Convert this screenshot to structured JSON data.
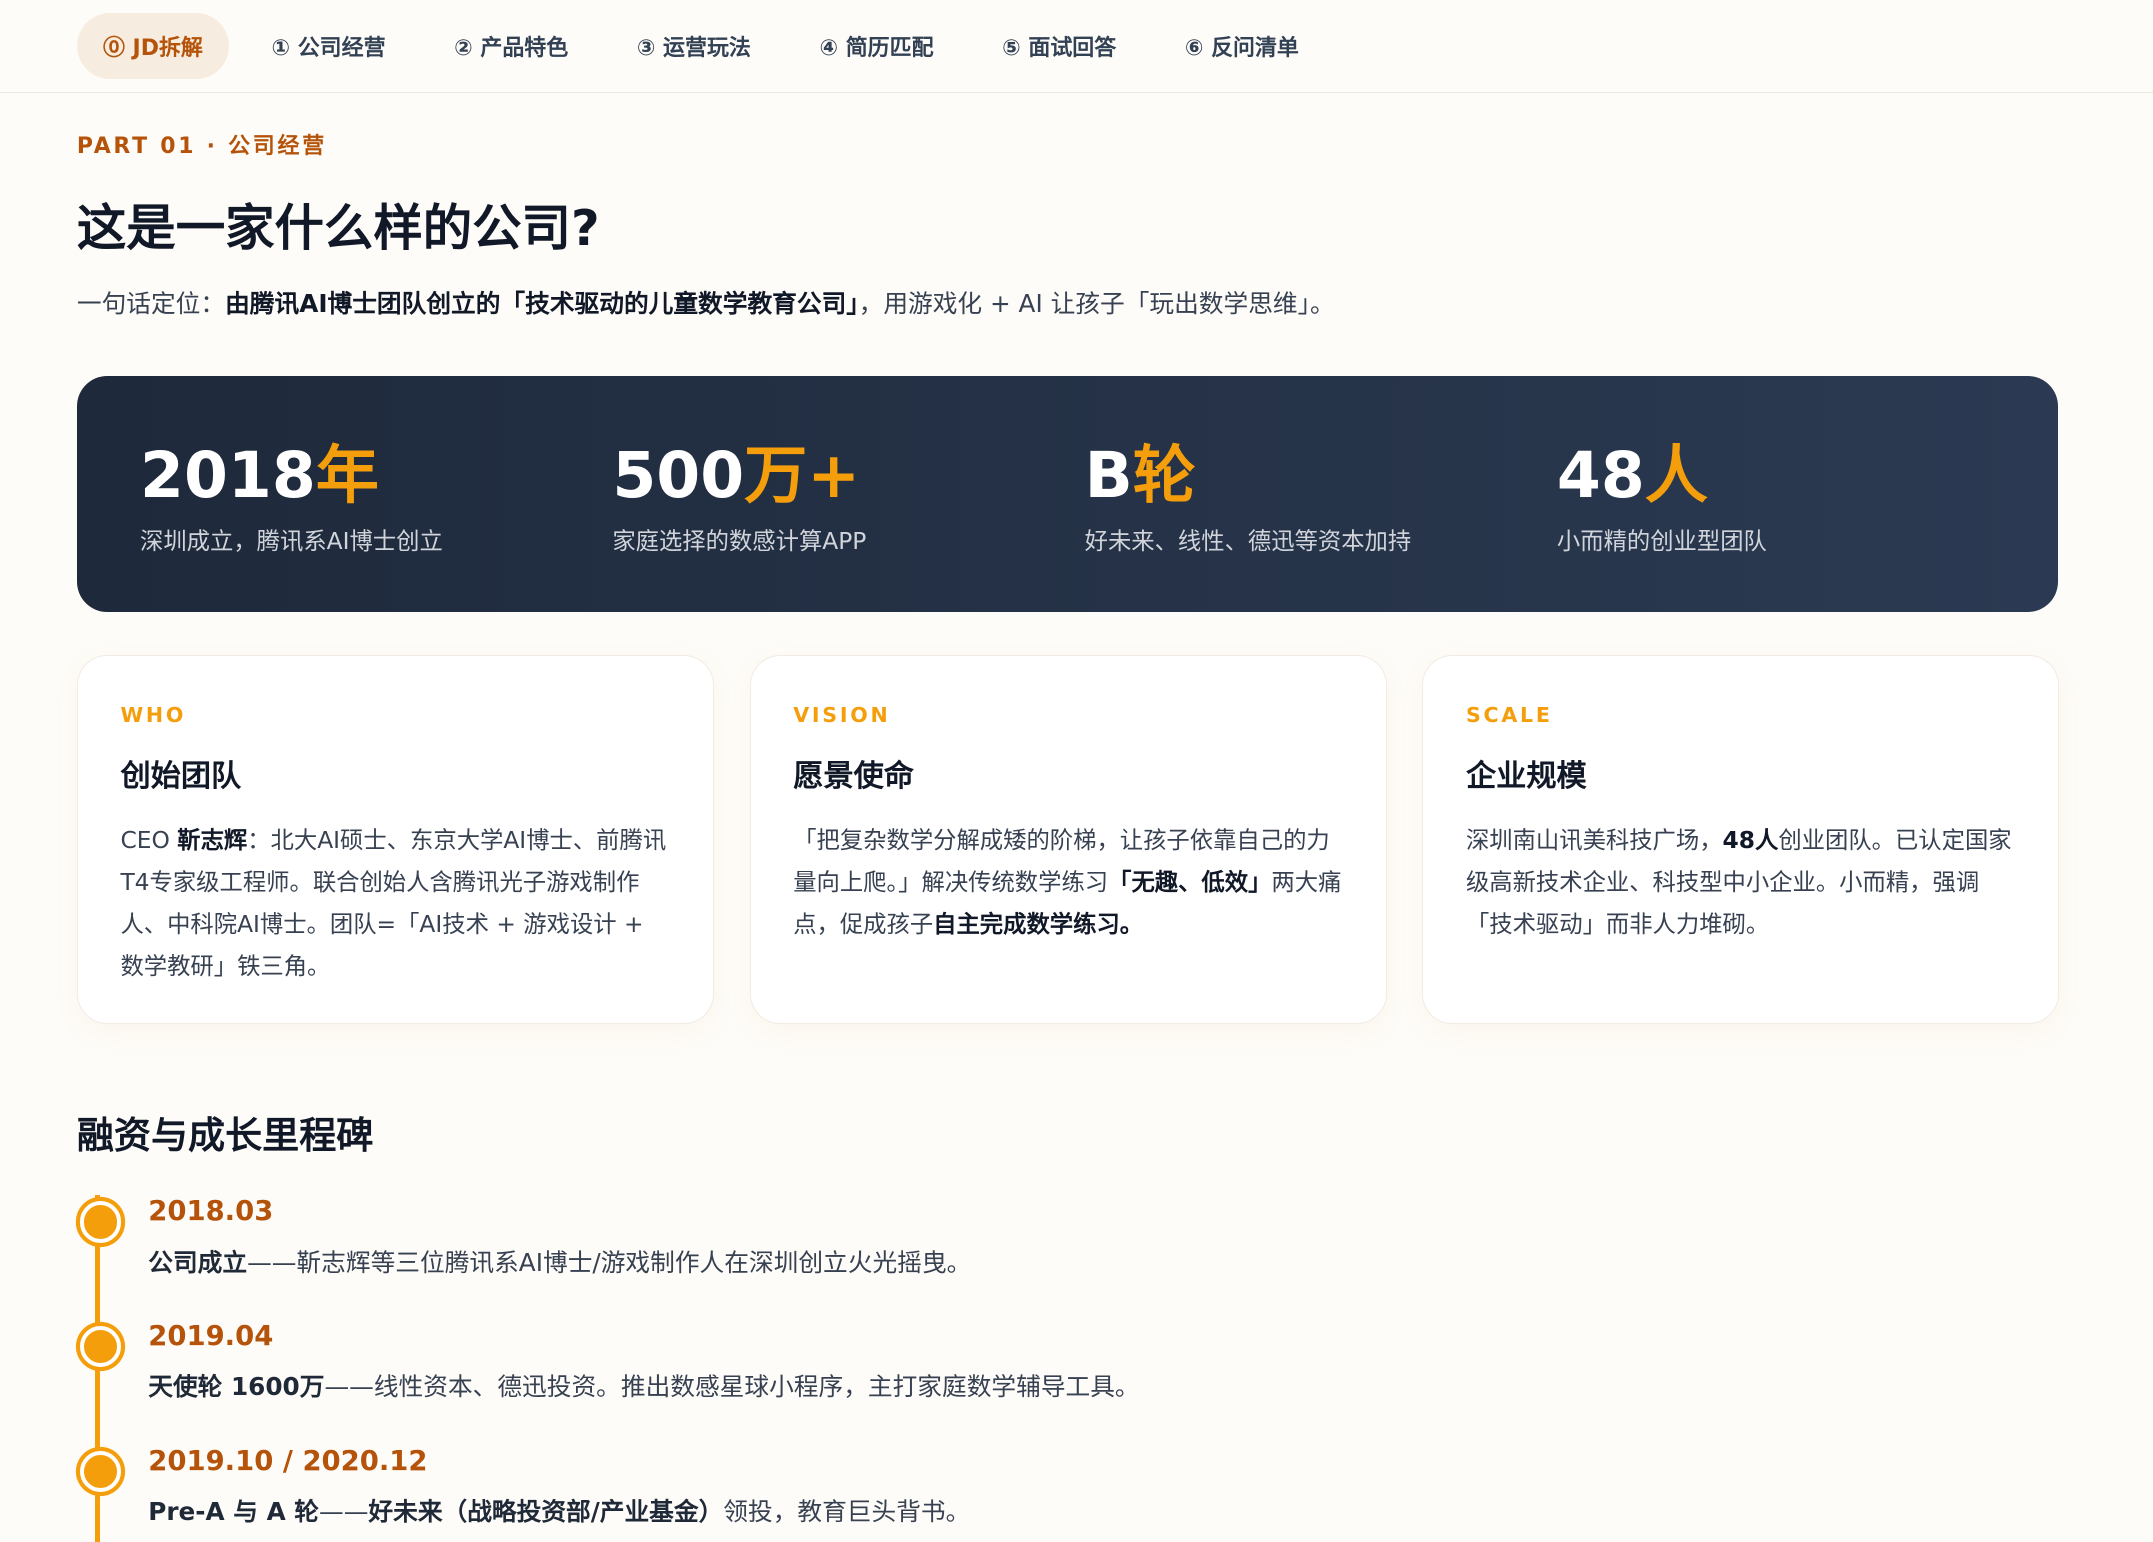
{
  "nav": {
    "tabs": [
      {
        "label": "⓪ JD拆解",
        "active": true
      },
      {
        "label": "① 公司经营",
        "active": false
      },
      {
        "label": "② 产品特色",
        "active": false
      },
      {
        "label": "③ 运营玩法",
        "active": false
      },
      {
        "label": "④ 简历匹配",
        "active": false
      },
      {
        "label": "⑤ 面试回答",
        "active": false
      },
      {
        "label": "⑥ 反问清单",
        "active": false
      }
    ]
  },
  "section": {
    "kicker": "PART 01 · 公司经营",
    "title": "这是一家什么样的公司?",
    "tagline_prefix": "一句话定位：",
    "tagline_bold": "由腾讯AI博士团队创立的「技术驱动的儿童数学教育公司」",
    "tagline_suffix": "，用游戏化 + AI 让孩子「玩出数学思维」。"
  },
  "stats": [
    {
      "num": "2018",
      "unit": "年",
      "desc": "深圳成立，腾讯系AI博士创立"
    },
    {
      "num": "500",
      "unit": "万+",
      "desc": "家庭选择的数感计算APP"
    },
    {
      "num": "B",
      "unit": "轮",
      "desc": "好未来、线性、德迅等资本加持"
    },
    {
      "num": "48",
      "unit": "人",
      "desc": "小而精的创业型团队"
    }
  ],
  "cards": [
    {
      "kicker": "WHO",
      "title": "创始团队",
      "p1": "CEO ",
      "b1": "靳志辉",
      "p2": "：北大AI硕士、东京大学AI博士、前腾讯T4专家级工程师。联合创始人含腾讯光子游戏制作人、中科院AI博士。团队=「AI技术 + 游戏设计 + 数学教研」铁三角。"
    },
    {
      "kicker": "VISION",
      "title": "愿景使命",
      "p1": "「把复杂数学分解成矮的阶梯，让孩子依靠自己的力量向上爬。」解决传统数学练习",
      "b1": "「无趣、低效」",
      "p2": "两大痛点，促成孩子",
      "b2": "自主完成数学练习。"
    },
    {
      "kicker": "SCALE",
      "title": "企业规模",
      "p1": "深圳南山讯美科技广场，",
      "b1": "48人",
      "p2": "创业团队。已认定国家级高新技术企业、科技型中小企业。小而精，强调「技术驱动」而非人力堆砌。"
    }
  ],
  "milestones": {
    "title": "融资与成长里程碑",
    "items": [
      {
        "date": "2018.03",
        "bold": "公司成立",
        "text": "——靳志辉等三位腾讯系AI博士/游戏制作人在深圳创立火光摇曳。",
        "bold2": "",
        "text2": ""
      },
      {
        "date": "2019.04",
        "bold": "天使轮 1600万",
        "text": "——线性资本、德迅投资。推出数感星球小程序，主打家庭数学辅导工具。",
        "bold2": "",
        "text2": ""
      },
      {
        "date": "2019.10 / 2020.12",
        "bold": "Pre-A 与 A 轮",
        "text": "——",
        "bold2": "好未来（战略投资部/产业基金）",
        "text2": "领投，教育巨头背书。"
      }
    ]
  },
  "colors": {
    "accent": "#f59e0b",
    "accent_dark": "#b45309",
    "band": "#1e293b"
  }
}
